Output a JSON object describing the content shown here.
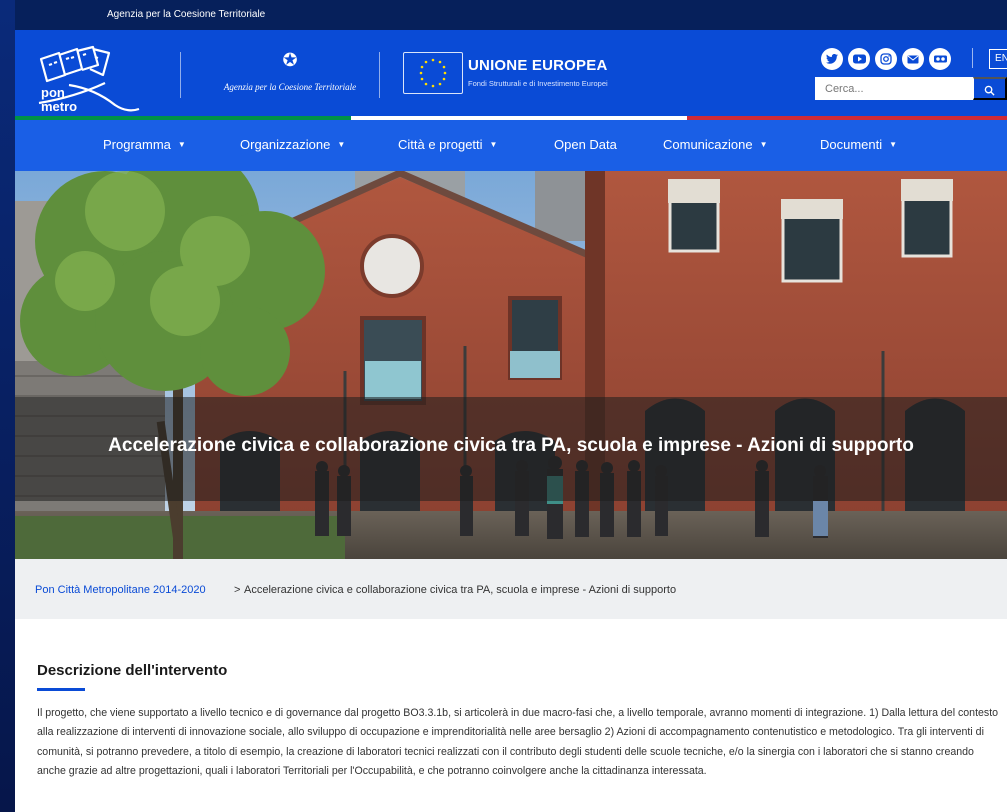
{
  "topbar": {
    "agency_label": "Agenzia per la Coesione Territoriale"
  },
  "header": {
    "logo_text_line1": "pon",
    "logo_text_line2": "metro",
    "agency_logo_text": "Agenzia per la Coesione Territoriale",
    "eu_title": "UNIONE EUROPEA",
    "eu_subtitle": "Fondi Strutturali e di Investimento Europei",
    "language": "EN",
    "search_placeholder": "Cerca...",
    "socials": [
      "twitter-icon",
      "youtube-icon",
      "instagram-icon",
      "mail-icon",
      "flickr-icon"
    ]
  },
  "nav": {
    "items": [
      {
        "label": "Programma",
        "dropdown": true
      },
      {
        "label": "Organizzazione",
        "dropdown": true
      },
      {
        "label": "Città e progetti",
        "dropdown": true
      },
      {
        "label": "Open Data",
        "dropdown": false
      },
      {
        "label": "Comunicazione",
        "dropdown": true
      },
      {
        "label": "Documenti",
        "dropdown": true
      }
    ]
  },
  "hero": {
    "title": "Accelerazione civica e collaborazione civica tra PA, scuola e imprese - Azioni di supporto"
  },
  "breadcrumb": {
    "home": "Pon Città Metropolitane 2014-2020",
    "separator": ">",
    "current": "Accelerazione civica e collaborazione civica tra PA, scuola e imprese - Azioni di supporto"
  },
  "content": {
    "section_title": "Descrizione dell'intervento",
    "body": "Il progetto, che viene supportato a livello tecnico e di governance dal progetto BO3.3.1b, si articolerà in due macro-fasi che, a livello temporale, avranno momenti di integrazione. 1) Dalla lettura del contesto alla realizzazione di interventi di innovazione sociale, allo sviluppo di occupazione e imprenditorialità nelle aree bersaglio 2) Azioni di accompagnamento contenutistico e metodologico. Tra gli interventi di comunità, si potranno prevedere, a titolo di esempio, la creazione di laboratori tecnici realizzati con il contributo degli studenti delle scuole tecniche, e/o la sinergia con i laboratori che si stanno creando anche grazie ad altre progettazioni, quali i laboratori Territoriali per l'Occupabilità, e che potranno coinvolgere anche la cittadinanza interessata."
  },
  "colors": {
    "topbar": "#06205b",
    "header": "#0a4bd6",
    "nav": "#1a5fe6",
    "link": "#0a4bd6",
    "flag_green": "#009246",
    "flag_white": "#ffffff",
    "flag_red": "#ce2b37"
  }
}
